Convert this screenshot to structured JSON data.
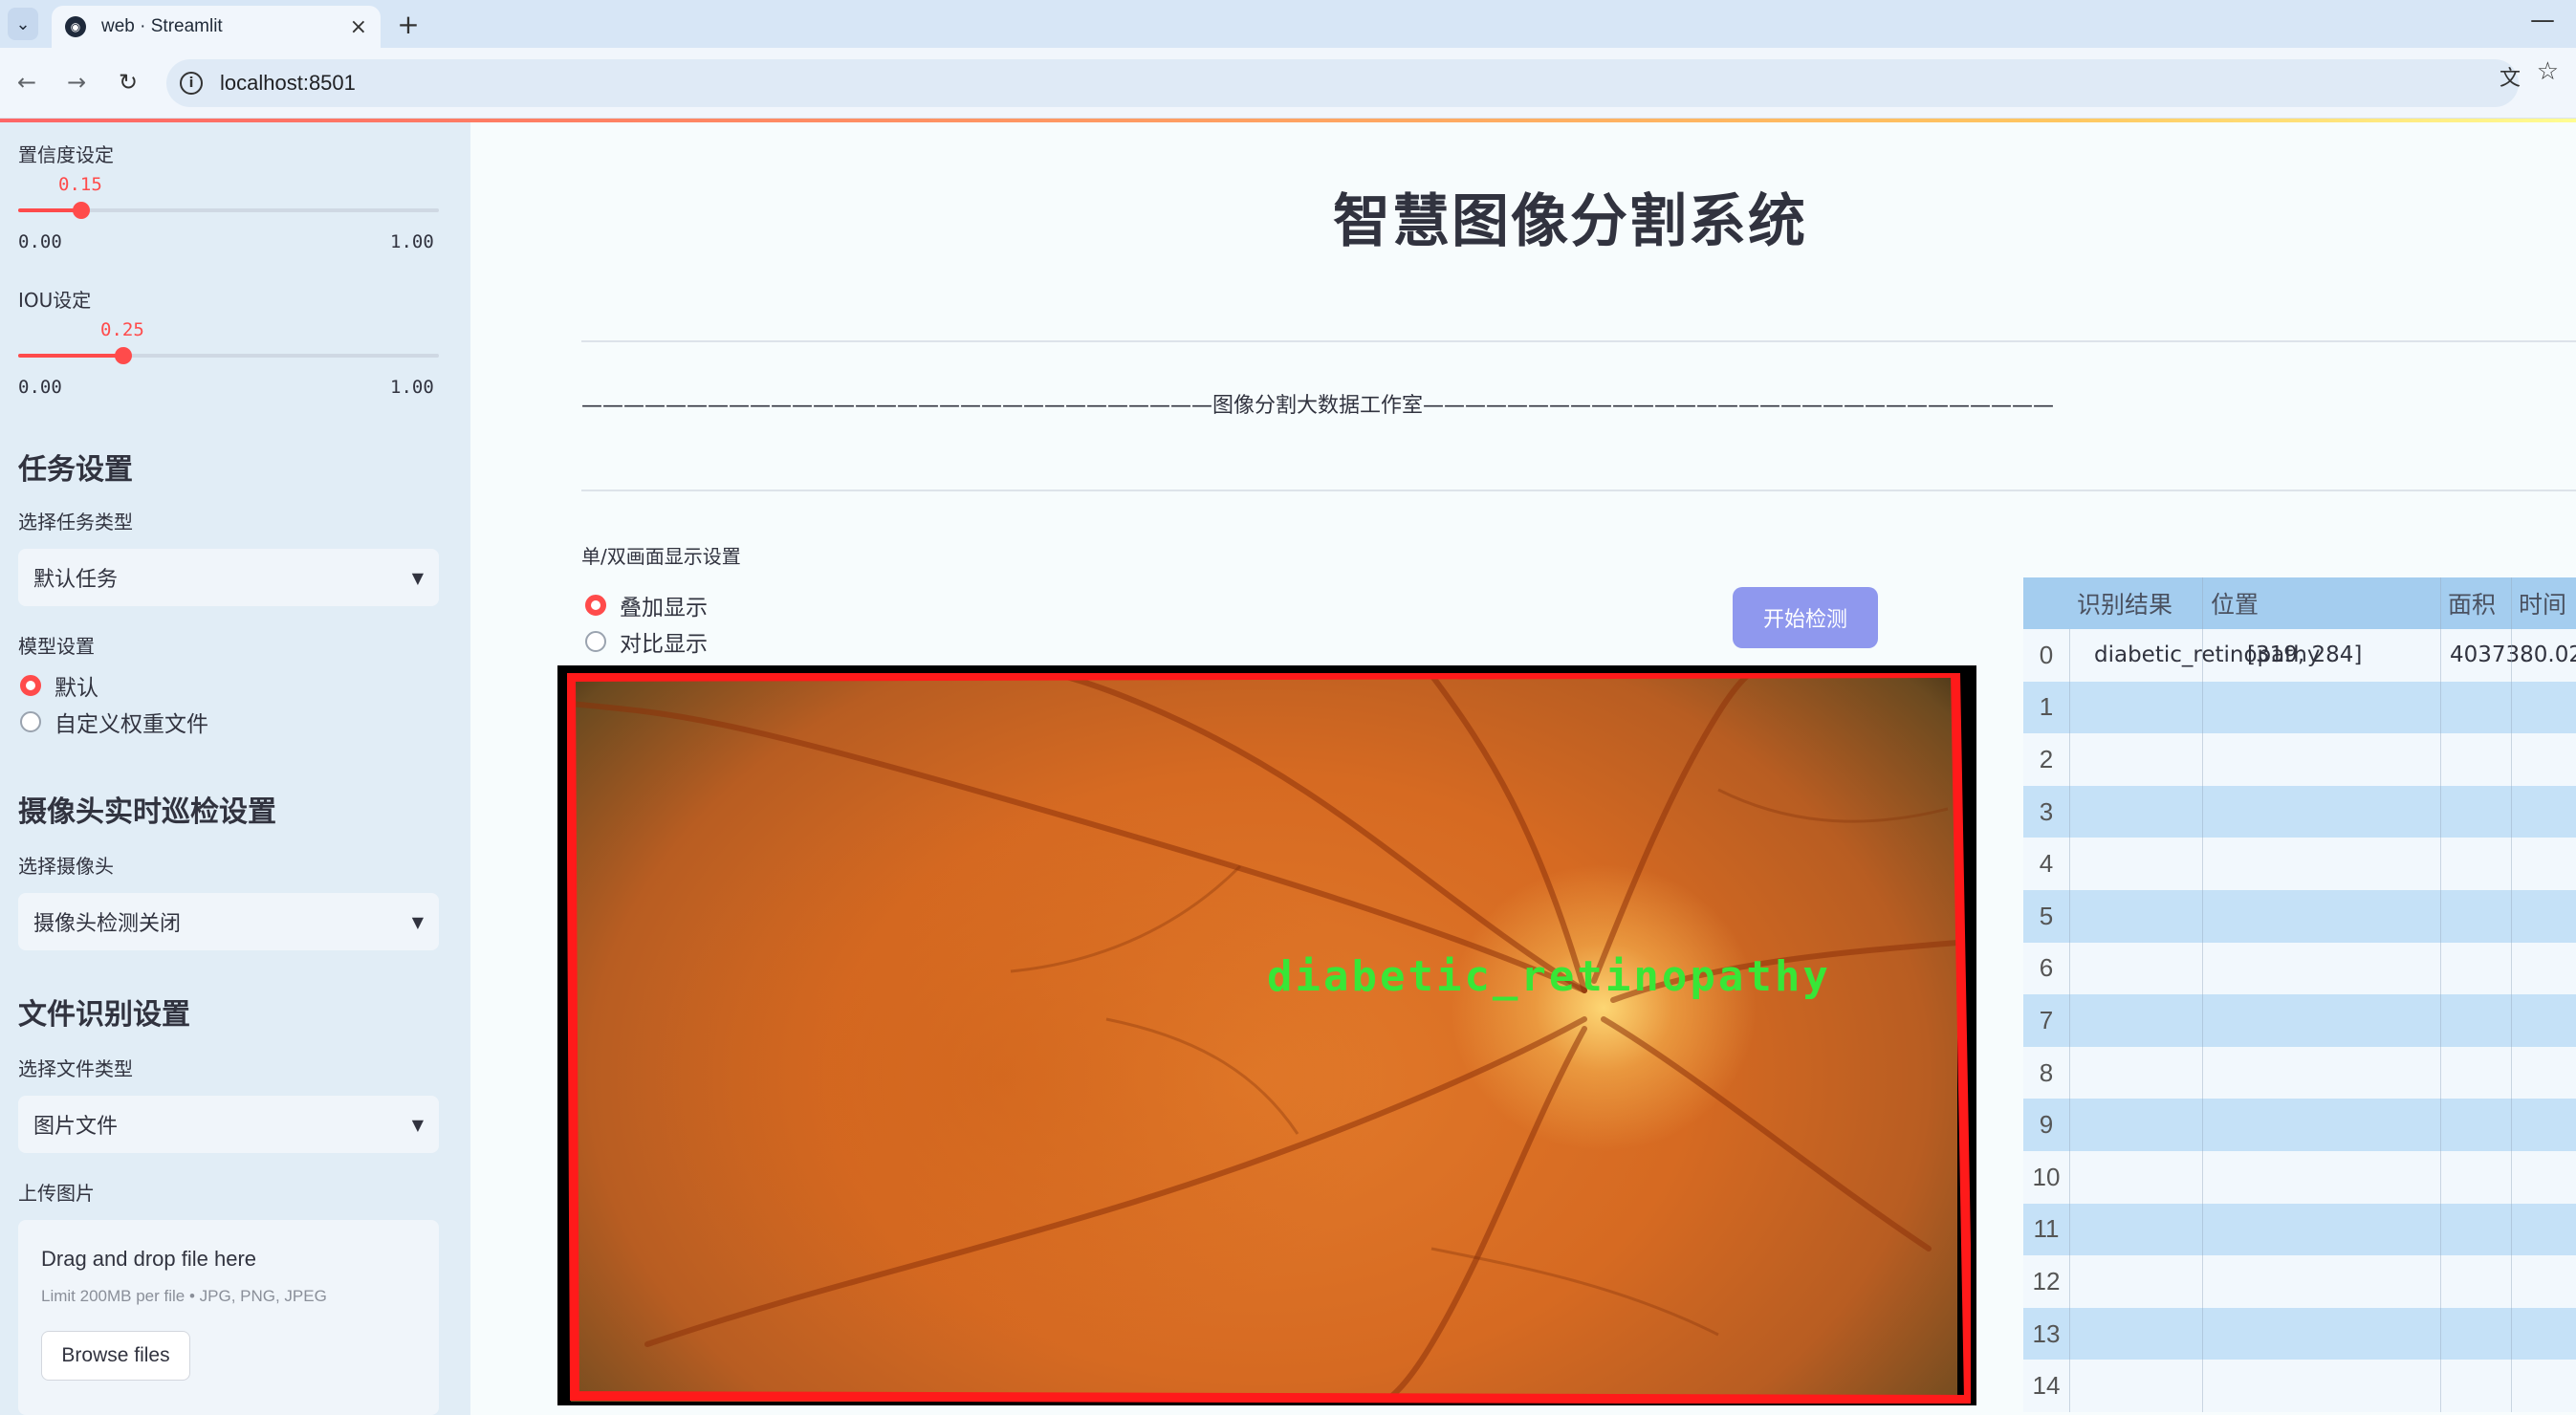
{
  "browser": {
    "tab_title": "web · Streamlit",
    "url": "localhost:8501"
  },
  "sidebar": {
    "confidence": {
      "label": "置信度设定",
      "value": "0.15",
      "value_fraction": 0.15,
      "min": "0.00",
      "max": "1.00"
    },
    "iou": {
      "label": "IOU设定",
      "value": "0.25",
      "value_fraction": 0.25,
      "min": "0.00",
      "max": "1.00"
    },
    "task_heading": "任务设置",
    "task_type_label": "选择任务类型",
    "task_type_value": "默认任务",
    "model_label": "模型设置",
    "model_options": [
      "默认",
      "自定义权重文件"
    ],
    "model_selected": 0,
    "camera_heading": "摄像头实时巡检设置",
    "camera_label": "选择摄像头",
    "camera_value": "摄像头检测关闭",
    "file_heading": "文件识别设置",
    "file_type_label": "选择文件类型",
    "file_type_value": "图片文件",
    "upload_label": "上传图片",
    "uploader": {
      "title": "Drag and drop file here",
      "limit": "Limit 200MB per file • JPG, PNG, JPEG",
      "button": "Browse files"
    }
  },
  "main": {
    "title": "智慧图像分割系统",
    "studio_line": "——————————————————————————————图像分割大数据工作室——————————————————————————————",
    "display_label": "单/双画面显示设置",
    "display_options": [
      "叠加显示",
      "对比显示"
    ],
    "display_selected": 0,
    "start_button": "开始检测",
    "detection_label": "diabetic_retinopathy"
  },
  "table": {
    "headers": [
      "识别结果",
      "位置",
      "面积",
      "时间"
    ],
    "rows": [
      {
        "index": "0",
        "result": "diabetic_retinopathy",
        "position": "[319, 284]",
        "area": "4037380.02",
        "time": ""
      },
      {
        "index": "1"
      },
      {
        "index": "2"
      },
      {
        "index": "3"
      },
      {
        "index": "4"
      },
      {
        "index": "5"
      },
      {
        "index": "6"
      },
      {
        "index": "7"
      },
      {
        "index": "8"
      },
      {
        "index": "9"
      },
      {
        "index": "10"
      },
      {
        "index": "11"
      },
      {
        "index": "12"
      },
      {
        "index": "13"
      },
      {
        "index": "14"
      }
    ]
  },
  "colors": {
    "accent": "#ff4b4b",
    "sidebar_bg": "#e1edf6",
    "button": "#8f98ee",
    "detection_text": "#38e637",
    "detection_box": "#ff1a1a"
  }
}
